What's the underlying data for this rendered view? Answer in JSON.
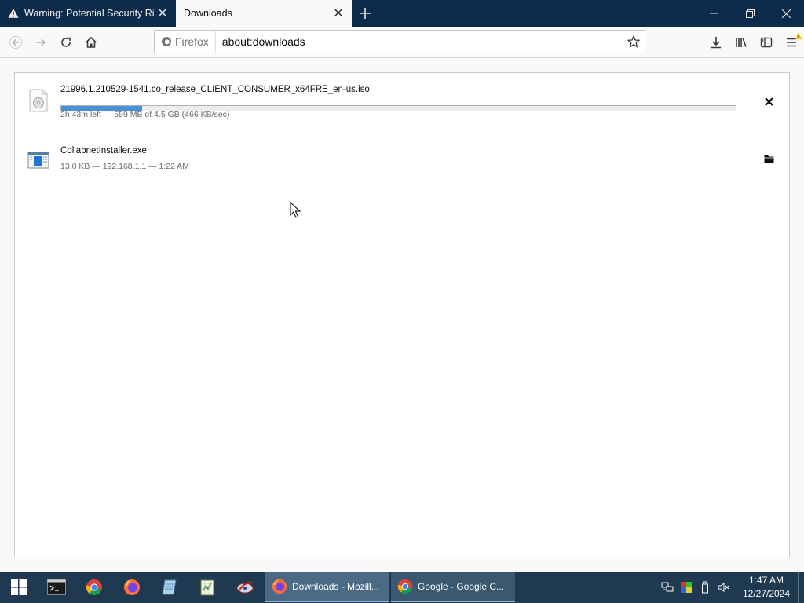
{
  "browser": {
    "tabs": [
      {
        "title": "Warning: Potential Security Risk Ahead",
        "icon": "warning-icon",
        "active": false
      },
      {
        "title": "Downloads",
        "active": true
      }
    ],
    "urlbar": {
      "identity_label": "Firefox",
      "url": "about:downloads"
    }
  },
  "downloads": [
    {
      "filename": "21996.1.210529-1541.co_release_CLIENT_CONSUMER_x64FRE_en-us.iso",
      "status": "2h 43m left — 559 MB of 4.5 GB (466 KB/sec)",
      "progress": 0.12,
      "icon": "disc-file-icon",
      "action": "cancel-icon"
    },
    {
      "filename": "CollabnetInstaller.exe",
      "status": "13.0 KB — 192.168.1.1 — 1:22 AM",
      "icon": "exe-file-icon",
      "action": "open-folder-icon"
    }
  ],
  "taskbar": {
    "pinned": [
      "terminal-icon",
      "chrome-icon",
      "firefox-icon",
      "notepad-icon",
      "spreadsheet-icon",
      "network-tool-icon"
    ],
    "apps": [
      {
        "label": "Downloads - Mozill...",
        "icon": "firefox-icon",
        "active": true
      },
      {
        "label": "Google - Google C...",
        "icon": "chrome-icon",
        "active": false
      }
    ],
    "clock": {
      "time": "1:47 AM",
      "date": "12/27/2024"
    }
  },
  "colors": {
    "tabstrip": "#0c2b4a",
    "progress": "#4a90d9",
    "taskbar": "#1f3a50"
  }
}
